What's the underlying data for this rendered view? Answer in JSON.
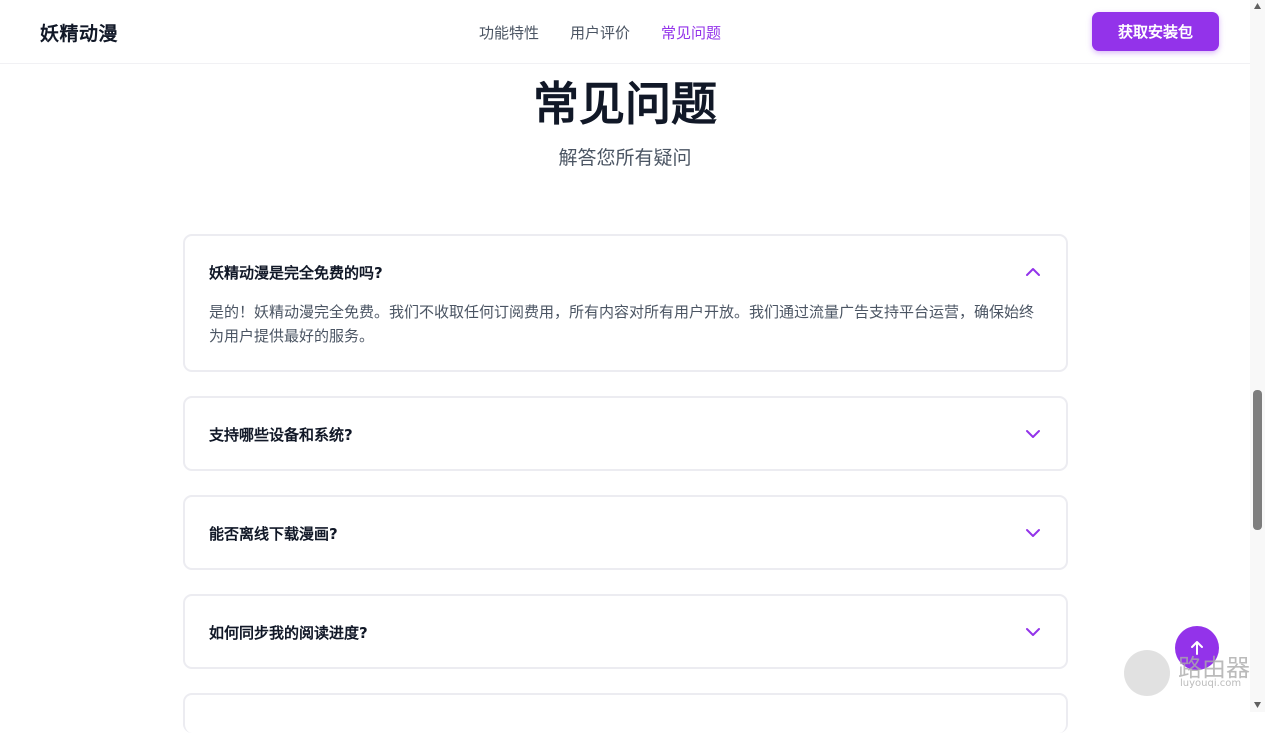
{
  "header": {
    "logo": "妖精动漫",
    "nav": [
      {
        "label": "功能特性"
      },
      {
        "label": "用户评价"
      },
      {
        "label": "常见问题",
        "active": true
      }
    ],
    "cta_label": "获取安装包"
  },
  "faq": {
    "title": "常见问题",
    "subtitle": "解答您所有疑问",
    "items": [
      {
        "question": "妖精动漫是完全免费的吗?",
        "answer": "是的！妖精动漫完全免费。我们不收取任何订阅费用，所有内容对所有用户开放。我们通过流量广告支持平台运营，确保始终为用户提供最好的服务。",
        "expanded": true,
        "icon": "chevron-up-icon"
      },
      {
        "question": "支持哪些设备和系统?",
        "expanded": false,
        "icon": "chevron-down-icon"
      },
      {
        "question": "能否离线下载漫画?",
        "expanded": false,
        "icon": "chevron-down-icon"
      },
      {
        "question": "如何同步我的阅读进度?",
        "expanded": false,
        "icon": "chevron-down-icon"
      }
    ]
  },
  "floating_button": {
    "icon": "arrow-up-icon"
  },
  "watermark": {
    "text": "路由器",
    "sub": "luyouqi.com"
  },
  "colors": {
    "accent": "#9333ea",
    "text": "#111827",
    "muted": "#4b5563",
    "border": "#ececf1"
  }
}
